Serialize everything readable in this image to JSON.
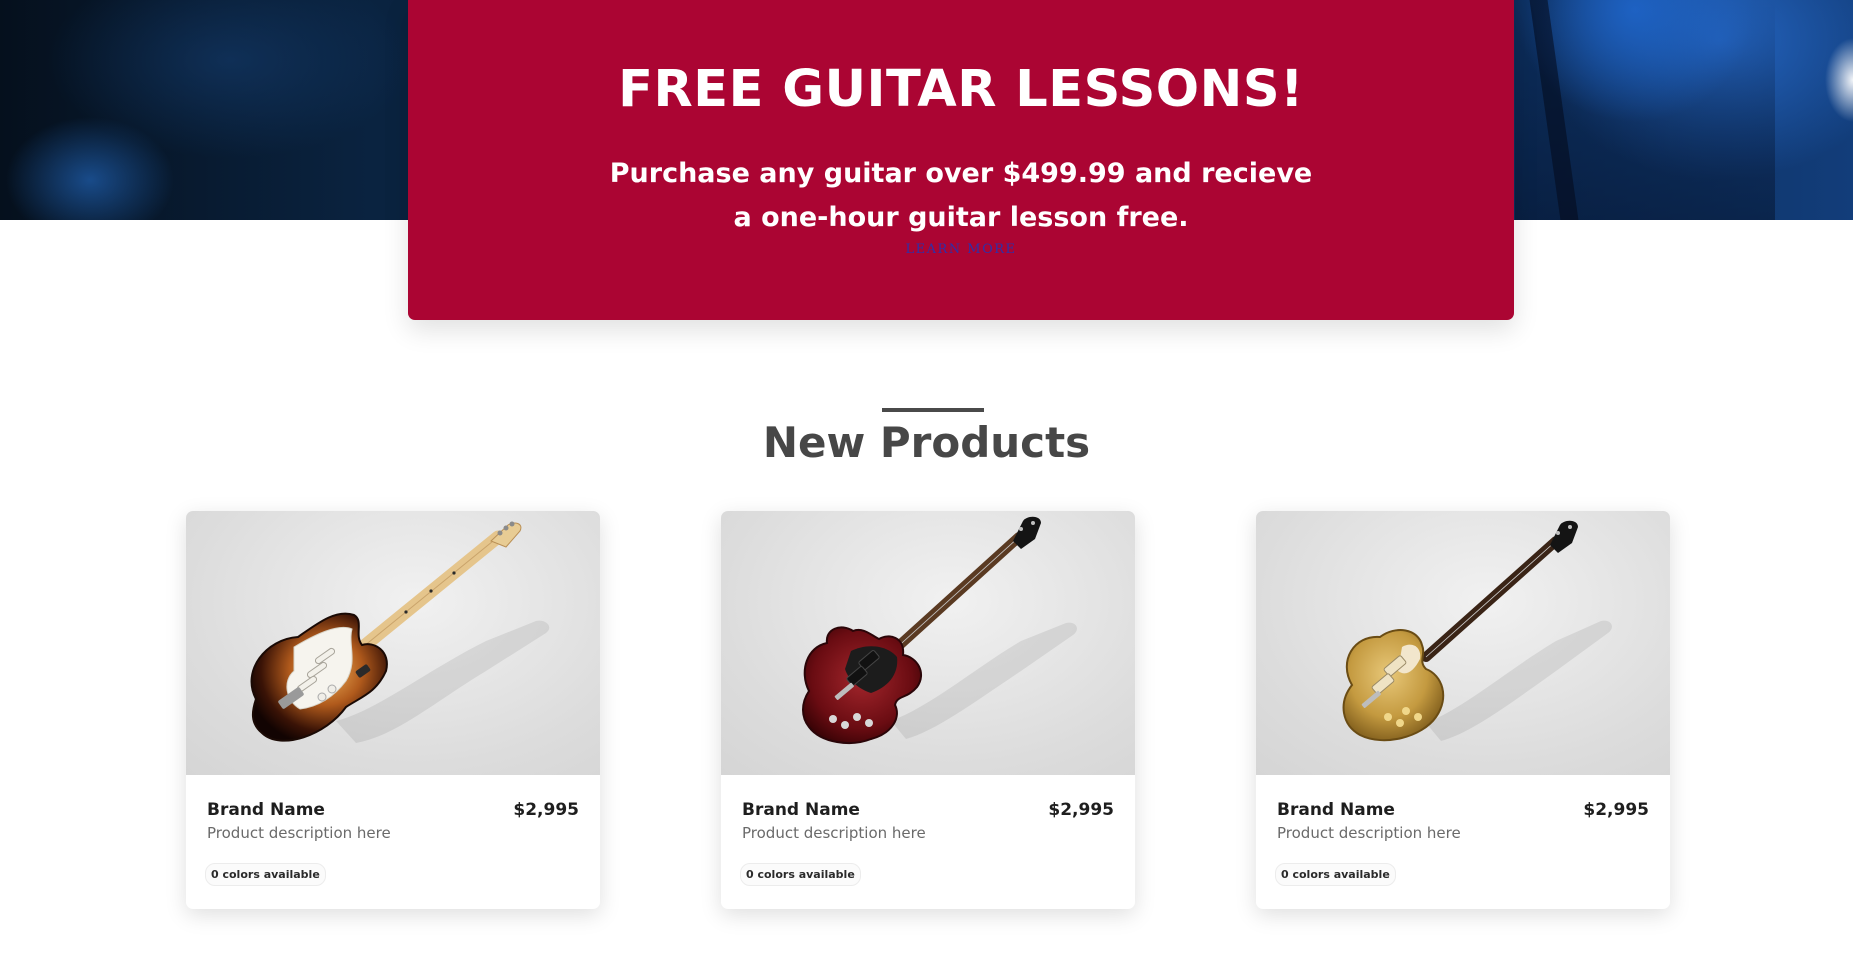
{
  "promo": {
    "title": "FREE GUITAR LESSONS!",
    "body_line1": "Purchase any guitar over $499.99 and recieve",
    "body_line2": "a one-hour guitar lesson free.",
    "link_label": "LEARN MORE"
  },
  "products_section": {
    "title": "New Products"
  },
  "products": [
    {
      "brand": "Brand Name",
      "price": "$2,995",
      "description": "Product description here",
      "colors_badge": "0 colors available",
      "image_icon": "stratocaster-guitar-icon"
    },
    {
      "brand": "Brand Name",
      "price": "$2,995",
      "description": "Product description here",
      "colors_badge": "0 colors available",
      "image_icon": "sg-guitar-icon"
    },
    {
      "brand": "Brand Name",
      "price": "$2,995",
      "description": "Product description here",
      "colors_badge": "0 colors available",
      "image_icon": "les-paul-guitar-icon"
    }
  ],
  "colors": {
    "promo_bg": "#ab0533",
    "link": "#2f2fa8",
    "heading": "#474747"
  }
}
